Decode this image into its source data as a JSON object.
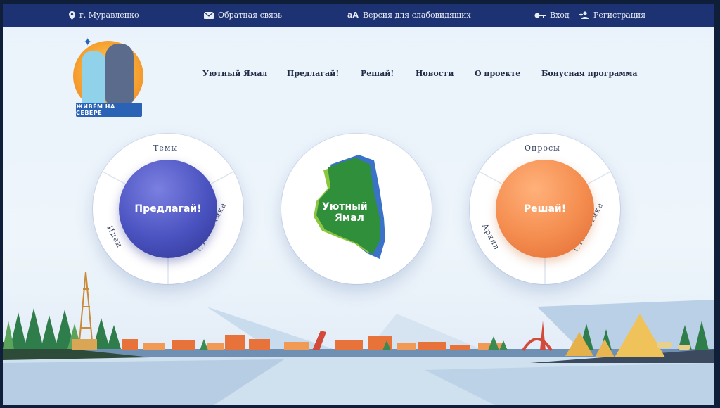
{
  "topbar": {
    "city": "г. Муравленко",
    "feedback": "Обратная связь",
    "accessibility": "Версия для слабовидящих",
    "login": "Вход",
    "register": "Регистрация"
  },
  "logo": {
    "banner_text": "ЖИВЁМ НА СЕВЕРЕ"
  },
  "nav": [
    "Уютный Ямал",
    "Предлагай!",
    "Решай!",
    "Новости",
    "О проекте",
    "Бонусная программа"
  ],
  "wheels": {
    "propose": {
      "center": "Предлагай!",
      "top": "Темы",
      "left": "Идеи",
      "right": "Статистика"
    },
    "cozy": {
      "line1": "Уютный",
      "line2": "Ямал"
    },
    "decide": {
      "center": "Решай!",
      "top": "Опросы",
      "left": "Архив",
      "right": "Статистика"
    }
  },
  "colors": {
    "topbar": "#1d3272",
    "propose_accent": "#4a52c0",
    "decide_accent": "#f48c4e",
    "cozy_green": "#2f8f3a",
    "cozy_blue": "#3a72c8"
  }
}
